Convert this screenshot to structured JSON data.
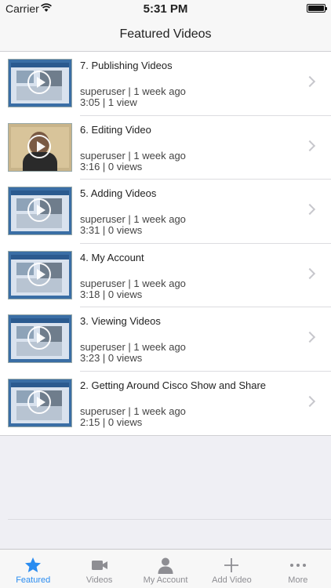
{
  "status_bar": {
    "carrier": "Carrier",
    "time": "5:31 PM"
  },
  "nav": {
    "title": "Featured Videos"
  },
  "videos": [
    {
      "title": "7. Publishing Videos",
      "meta": "superuser | 1 week ago",
      "stats": "3:05 | 1 view"
    },
    {
      "title": "6. Editing Video",
      "meta": "superuser | 1 week ago",
      "stats": "3:16 | 0 views"
    },
    {
      "title": "5. Adding Videos",
      "meta": "superuser | 1 week ago",
      "stats": "3:31 | 0 views"
    },
    {
      "title": "4. My Account",
      "meta": "superuser | 1 week ago",
      "stats": "3:18 | 0 views"
    },
    {
      "title": "3. Viewing Videos",
      "meta": "superuser | 1 week ago",
      "stats": "3:23 | 0 views"
    },
    {
      "title": "2. Getting Around Cisco Show and Share",
      "meta": "superuser | 1 week ago",
      "stats": "2:15 | 0 views"
    }
  ],
  "tabs": [
    {
      "label": "Featured",
      "icon": "star-icon",
      "active": true
    },
    {
      "label": "Videos",
      "icon": "video-camera-icon",
      "active": false
    },
    {
      "label": "My Account",
      "icon": "person-icon",
      "active": false
    },
    {
      "label": "Add Video",
      "icon": "plus-icon",
      "active": false
    },
    {
      "label": "More",
      "icon": "more-dots-icon",
      "active": false
    }
  ],
  "colors": {
    "accent": "#2a8cf0",
    "inactive": "#8e8e93",
    "background": "#efeff4"
  }
}
